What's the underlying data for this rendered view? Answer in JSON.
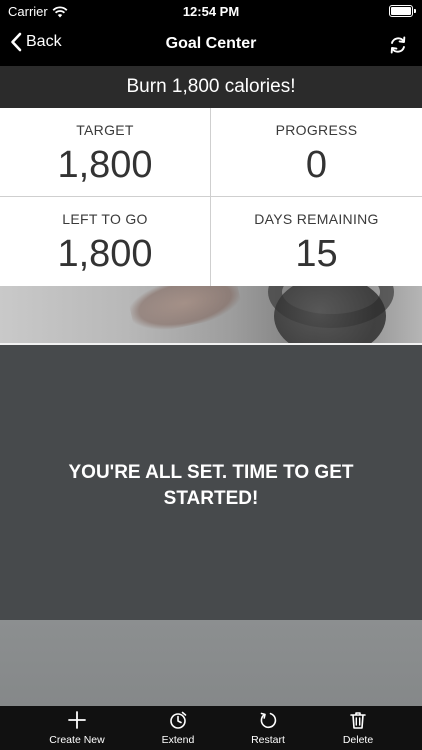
{
  "status_bar": {
    "carrier": "Carrier",
    "time": "12:54 PM"
  },
  "nav": {
    "back_label": "Back",
    "title": "Goal Center"
  },
  "goal": {
    "banner": "Burn 1,800 calories!"
  },
  "stats": [
    {
      "label": "TARGET",
      "value": "1,800"
    },
    {
      "label": "PROGRESS",
      "value": "0"
    },
    {
      "label": "LEFT TO GO",
      "value": "1,800"
    },
    {
      "label": "DAYS REMAINING",
      "value": "15"
    }
  ],
  "message": "YOU'RE ALL SET. TIME TO GET STARTED!",
  "tab_bar": {
    "items": [
      {
        "label": "Create New",
        "icon": "plus-icon"
      },
      {
        "label": "Extend",
        "icon": "timer-icon"
      },
      {
        "label": "Restart",
        "icon": "restart-icon"
      },
      {
        "label": "Delete",
        "icon": "trash-icon"
      }
    ]
  },
  "colors": {
    "nav_background": "#000000",
    "banner_background": "#2b2b2b",
    "panel_background": "#474a4c",
    "tab_bar_background": "#111111"
  }
}
